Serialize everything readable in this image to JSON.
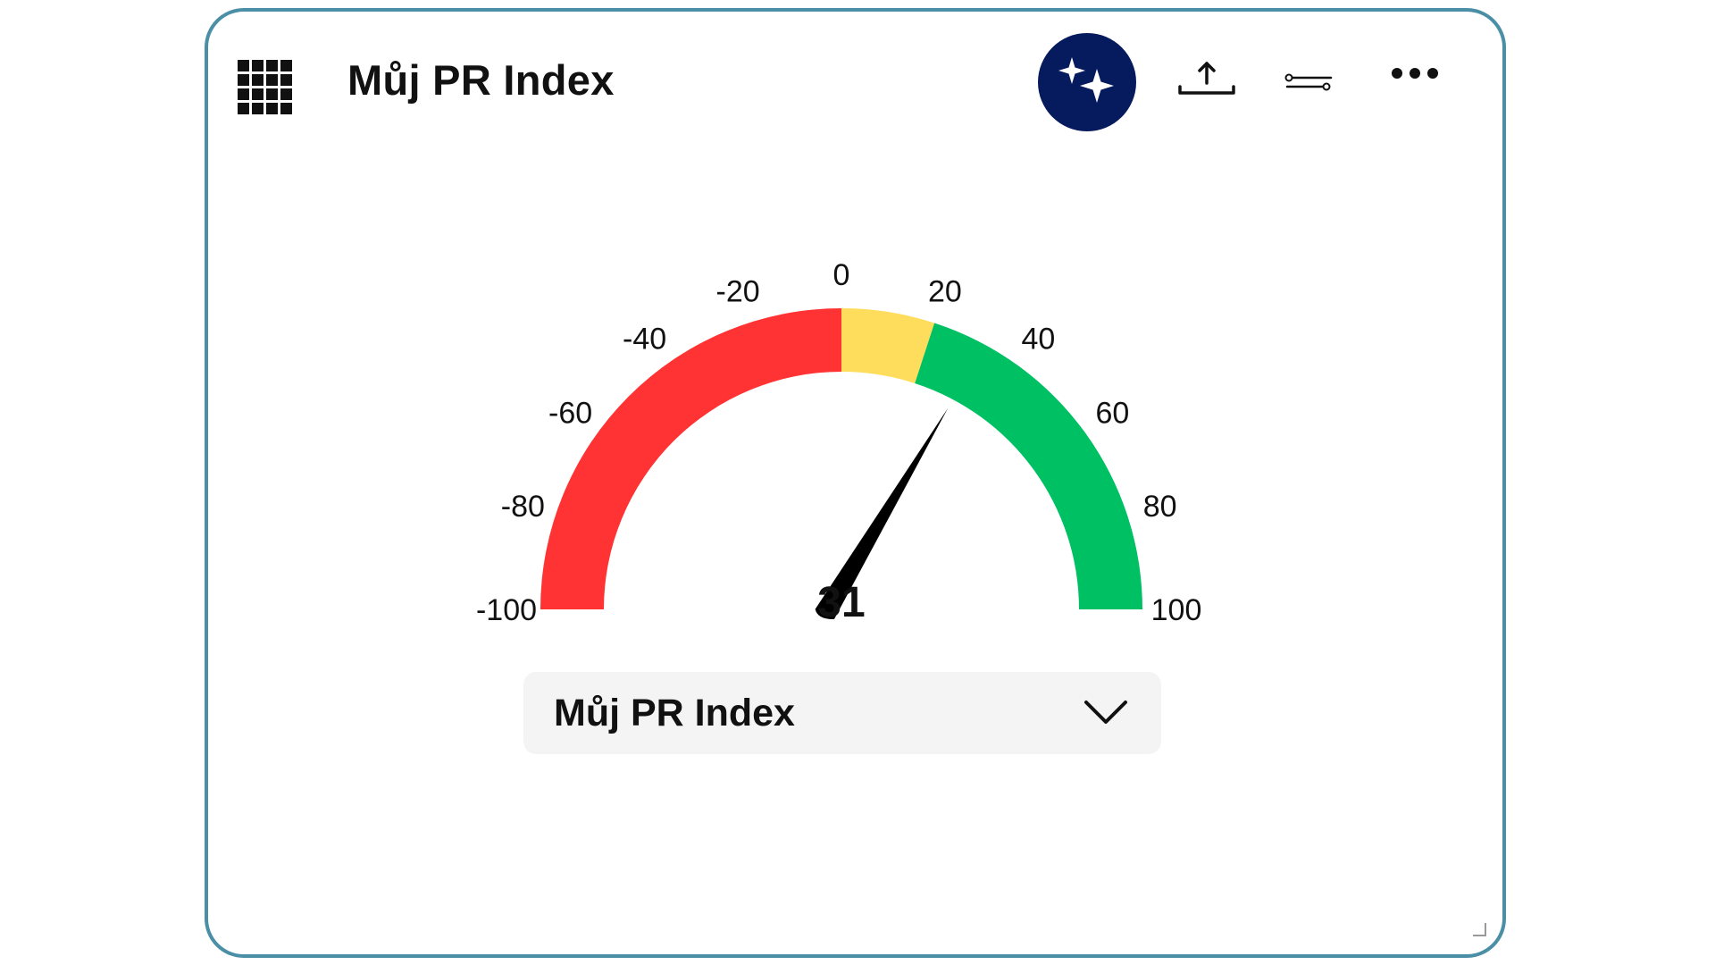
{
  "header": {
    "title": "Můj PR Index",
    "icons": [
      "apps-grid-icon",
      "sparkle-icon",
      "upload-icon",
      "filter-slider-icon",
      "more-horizontal-icon"
    ]
  },
  "gauge": {
    "value": 31,
    "value_label": "31",
    "min": -100,
    "max": 100,
    "ticks": [
      "-100",
      "-80",
      "-60",
      "-40",
      "-20",
      "0",
      "20",
      "40",
      "60",
      "80",
      "100"
    ],
    "bands": [
      {
        "from": -100,
        "to": 0,
        "color": "#ff3333"
      },
      {
        "from": 0,
        "to": 20,
        "color": "#ffdd5c"
      },
      {
        "from": 20,
        "to": 100,
        "color": "#00c064"
      }
    ],
    "needle_color": "#000000"
  },
  "selector": {
    "selected": "Můj PR Index"
  },
  "colors": {
    "border": "#4a8fa6",
    "ai_button": "#061a5e",
    "select_bg": "#f4f4f4"
  }
}
